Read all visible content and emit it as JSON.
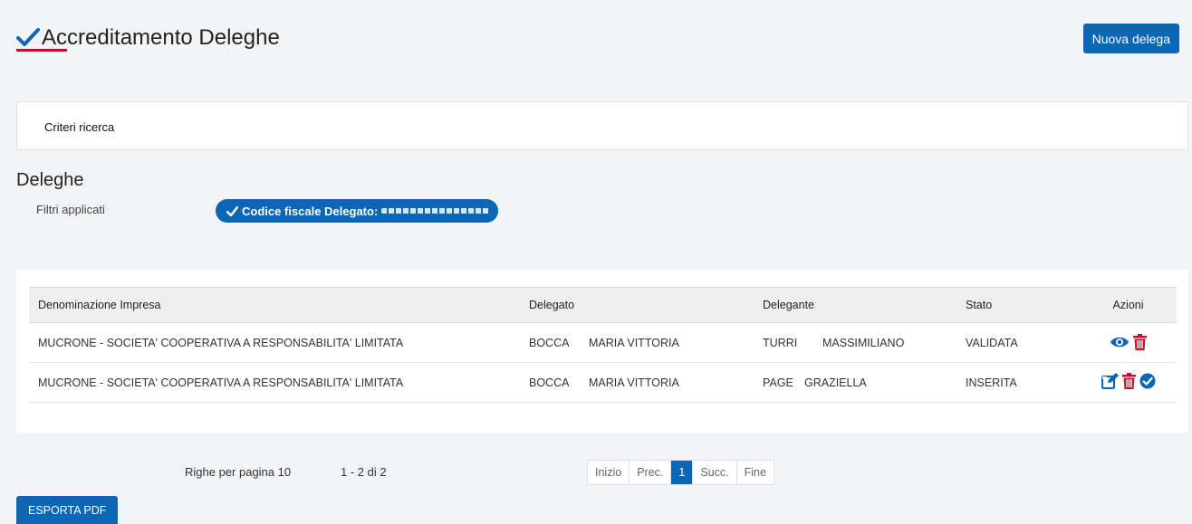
{
  "header": {
    "title": "Accreditamento Deleghe",
    "new_button": "Nuova delega"
  },
  "search": {
    "label": "Criteri ricerca"
  },
  "section": {
    "title": "Deleghe",
    "filters_label": "Filtri applicati",
    "filter_pill": "Codice fiscale Delegato:"
  },
  "table": {
    "headers": [
      "Denominazione Impresa",
      "Delegato",
      "Delegante",
      "Stato",
      "Azioni"
    ],
    "rows": [
      {
        "impresa": "MUCRONE - SOCIETA' COOPERATIVA A RESPONSABILITA' LIMITATA",
        "delegato_cognome": "BOCCA",
        "delegato_nome": "MARIA VITTORIA",
        "delegante_cognome": "TURRI",
        "delegante_nome": "MASSIMILIANO",
        "stato": "VALIDATA",
        "actions": [
          "eye-icon",
          "trash-icon"
        ]
      },
      {
        "impresa": "MUCRONE - SOCIETA' COOPERATIVA A RESPONSABILITA' LIMITATA",
        "delegato_cognome": "BOCCA",
        "delegato_nome": "MARIA VITTORIA",
        "delegante_cognome": "PAGE",
        "delegante_nome": "GRAZIELLA",
        "stato": "INSERITA",
        "actions": [
          "edit-icon",
          "trash-icon",
          "check-circle-icon"
        ]
      }
    ]
  },
  "pager": {
    "rows_per_page": "Righe per pagina 10",
    "range": "1 - 2 di 2",
    "buttons": [
      "Inizio",
      "Prec.",
      "1",
      "Succ.",
      "Fine"
    ],
    "active": "1"
  },
  "export_button": "ESPORTA PDF",
  "colors": {
    "primary": "#0b66b3",
    "accent_red": "#b0191e"
  }
}
